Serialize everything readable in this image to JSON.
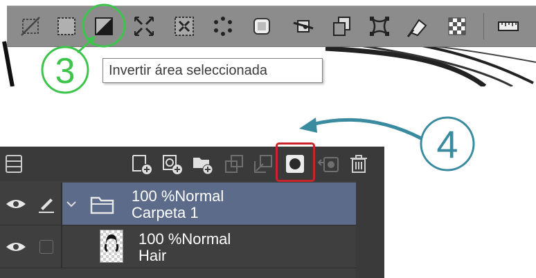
{
  "tooltip": {
    "text": "Invertir área seleccionada"
  },
  "callouts": {
    "step_three": "3",
    "step_four": "4"
  },
  "toolbar_icons": [
    "deselect-icon",
    "select-all-icon",
    "invert-selection-icon",
    "shrink-selection-icon",
    "expand-selection-icon",
    "dotted-selection-icon",
    "selection-layer-icon",
    "crop-icon",
    "copy-paste-icon",
    "transform-icon",
    "fill-icon",
    "checker-icon",
    "ruler-icon"
  ],
  "layer_toolbar_icons": [
    "layer-properties-icon",
    "new-raster-layer-icon",
    "new-vector-layer-icon",
    "new-folder-icon",
    "transfer-down-icon",
    "combine-icon",
    "create-layer-mask-icon",
    "apply-mask-icon",
    "delete-layer-icon"
  ],
  "layers": [
    {
      "opacity_blend": "100 %Normal",
      "name": "Carpeta 1",
      "type": "folder",
      "selected": true
    },
    {
      "opacity_blend": "100 %Normal",
      "name": "Hair",
      "type": "raster",
      "selected": false
    }
  ],
  "colors": {
    "highlight_red": "#c8252a",
    "callout_green": "#3cc44b",
    "callout_teal": "#3a8aa0",
    "selected_row": "#5b6b89"
  }
}
